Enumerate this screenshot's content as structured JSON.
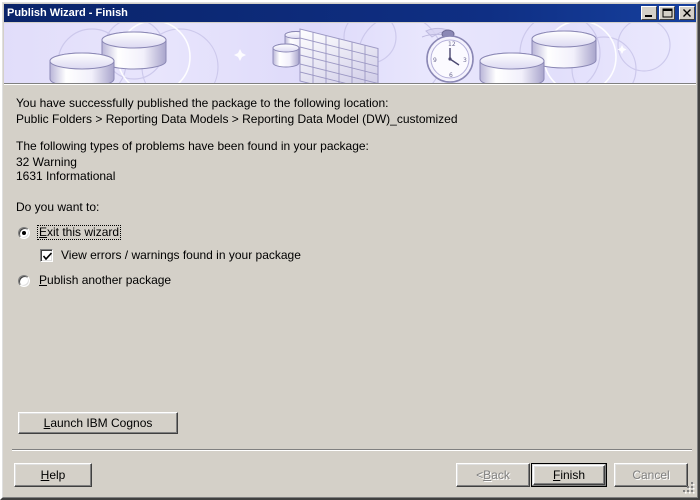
{
  "window": {
    "title": "Publish Wizard - Finish",
    "title_bar_color": "#0a246a",
    "face_color": "#d4d0c8",
    "banner_color": "#e4e1fb",
    "buttons": [
      {
        "name": "minimize",
        "glyph": "minimize-icon"
      },
      {
        "name": "maximize",
        "glyph": "maximize-icon"
      },
      {
        "name": "close",
        "glyph": "close-icon"
      }
    ]
  },
  "banner": {
    "graphics": [
      "database-cylinder",
      "grid-table",
      "pocket-watch",
      "circles"
    ]
  },
  "content": {
    "success_line": "You have successfully published the package to the following location:",
    "location_path": "Public Folders > Reporting Data Models > Reporting Data Model (DW)_customized",
    "problems_heading": "The following types of problems have been found in your package:",
    "warning_count": "32",
    "warning_label": "Warning",
    "informational_count": "1631",
    "informational_label": "Informational",
    "warning_line": "32  Warning",
    "informational_line": "1631  Informational",
    "question": "Do you want to:"
  },
  "options": {
    "exit": {
      "label": "Exit this wizard",
      "accesskey": "E",
      "label_rest": "xit this wizard",
      "selected": true,
      "focused": true
    },
    "view_errors": {
      "label": "View errors / warnings found in your package",
      "checked": true
    },
    "publish_another": {
      "label": "Publish another package",
      "accesskey": "P",
      "label_rest": "ublish another package",
      "selected": false
    }
  },
  "actions": {
    "launch": {
      "accesskey": "L",
      "label_rest": "aunch IBM Cognos",
      "label": "Launch IBM Cognos",
      "enabled": true
    },
    "help": {
      "accesskey": "H",
      "label_rest": "elp",
      "label": "Help",
      "enabled": true
    },
    "back": {
      "prefix": "< ",
      "accesskey": "B",
      "label_rest": "ack",
      "label": "< Back",
      "enabled": false
    },
    "finish": {
      "accesskey": "F",
      "label_rest": "inish",
      "label": "Finish",
      "enabled": true,
      "default": true
    },
    "cancel": {
      "label": "Cancel",
      "enabled": false
    }
  }
}
